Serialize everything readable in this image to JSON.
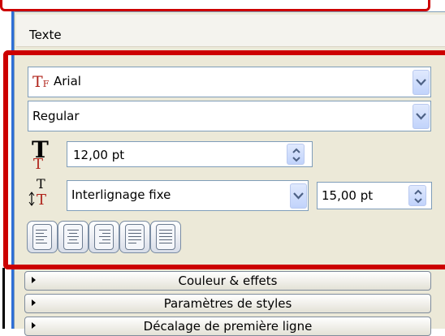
{
  "panel": {
    "title": "Texte"
  },
  "text_props": {
    "font_name": "Arial",
    "font_style": "Regular",
    "font_size": "12,00 pt",
    "line_spacing_mode": "Interlignage fixe",
    "line_spacing_value": "15,00 pt"
  },
  "alignment": [
    "align-left-icon",
    "align-center-icon",
    "align-right-icon",
    "justify-icon",
    "force-justify-icon"
  ],
  "sections": [
    {
      "label": "Couleur & effets"
    },
    {
      "label": "Paramètres de styles"
    },
    {
      "label": "Décalage de première ligne"
    }
  ],
  "colors": {
    "highlight": "#cc0000",
    "icon_red": "#b0241b",
    "panel_bg": "#ece9d8"
  }
}
